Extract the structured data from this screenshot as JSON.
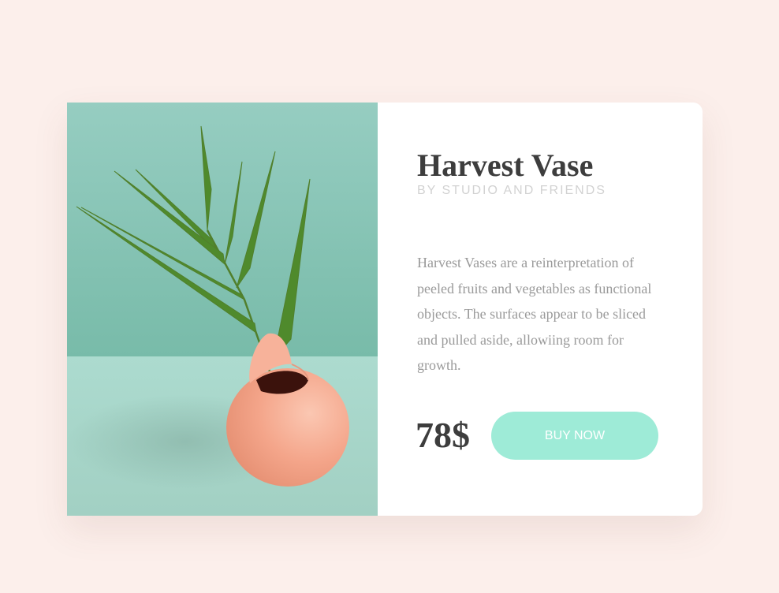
{
  "product": {
    "title": "Harvest Vase",
    "subtitle": "BY STUDIO AND FRIENDS",
    "description": "Harvest Vases are a reinterpretation of peeled fruits and vegetables as functional objects. The surfaces appear to be sliced and pulled aside, allowiing room for growth.",
    "price": "78$",
    "buy_label": "BUY NOW"
  },
  "colors": {
    "page_background": "#fcefeb",
    "card_background": "#ffffff",
    "title_text": "#3d3d3d",
    "subtitle_text": "#d2d2d2",
    "body_text": "#9a9a9a",
    "button_background": "#9eebd7",
    "button_text": "#ffffff",
    "photo_wall": "#8fcbbd",
    "photo_table": "#a8d7cb",
    "vase": "#f4a58a",
    "leaves": "#4f8a2c"
  }
}
